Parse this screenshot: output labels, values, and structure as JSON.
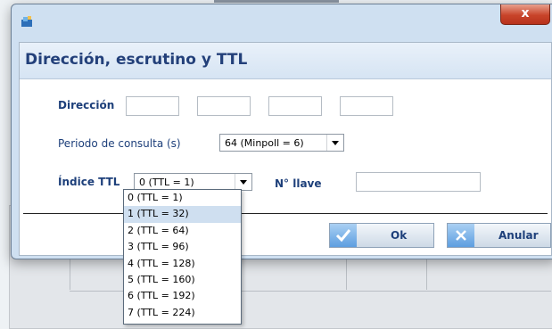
{
  "dialog": {
    "title": "Dirección, escrutino y TTL",
    "close_label": "x"
  },
  "form": {
    "direccion_label": "Dirección",
    "direccion_octets": [
      "",
      "",
      "",
      ""
    ],
    "periodo_label": "Periodo de consulta (s)",
    "periodo_value": "64 (Minpoll = 6)",
    "ttl_label": "Índice TTL",
    "ttl_value": "0 (TTL = 1)",
    "llave_label": "N° llave",
    "llave_value": ""
  },
  "ttl_options": [
    "0 (TTL = 1)",
    "1 (TTL = 32)",
    "2 (TTL = 64)",
    "3 (TTL = 96)",
    "4 (TTL = 128)",
    "5 (TTL = 160)",
    "6 (TTL = 192)",
    "7 (TTL = 224)"
  ],
  "ttl_highlighted_index": 1,
  "buttons": {
    "ok_label": "Ok",
    "cancel_label": "Anular"
  },
  "icons": {
    "app": "app-icon",
    "ok": "checkmark-icon",
    "cancel": "x-icon"
  },
  "colors": {
    "title": "#23407a",
    "close": "#c8442a",
    "highlight": "#cfdff0"
  }
}
